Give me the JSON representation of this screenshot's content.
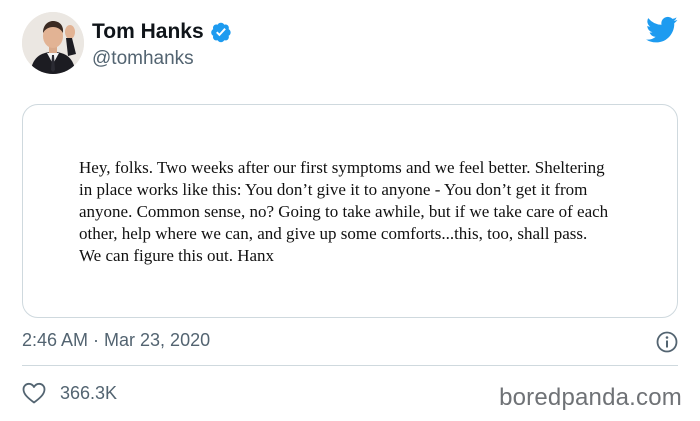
{
  "author": {
    "display_name": "Tom Hanks",
    "handle": "@tomhanks",
    "verified": true,
    "avatar_icon": "profile-photo"
  },
  "brand": {
    "icon": "twitter-bird-icon",
    "color": "#1d9bf0"
  },
  "media_image": {
    "lines": [
      "Hey, folks. Two weeks after our first symptoms and we feel better. Sheltering",
      "in place works like this: You don’t give it to anyone - You don’t get it from",
      "anyone. Common sense, no? Going to take awhile, but if we take care of each",
      "other, help where we can, and give up some comforts...this, too, shall pass.",
      "We can figure this out.  Hanx"
    ]
  },
  "meta": {
    "timestamp": "2:46 AM · Mar 23, 2020",
    "info_icon": "info-icon"
  },
  "engagement": {
    "like_icon": "heart-icon",
    "like_count": "366.3K"
  },
  "watermark": "boredpanda.com",
  "colors": {
    "text_primary": "#0f1419",
    "text_secondary": "#536471",
    "border": "#cfd9de",
    "verified_badge": "#1d9bf0"
  }
}
